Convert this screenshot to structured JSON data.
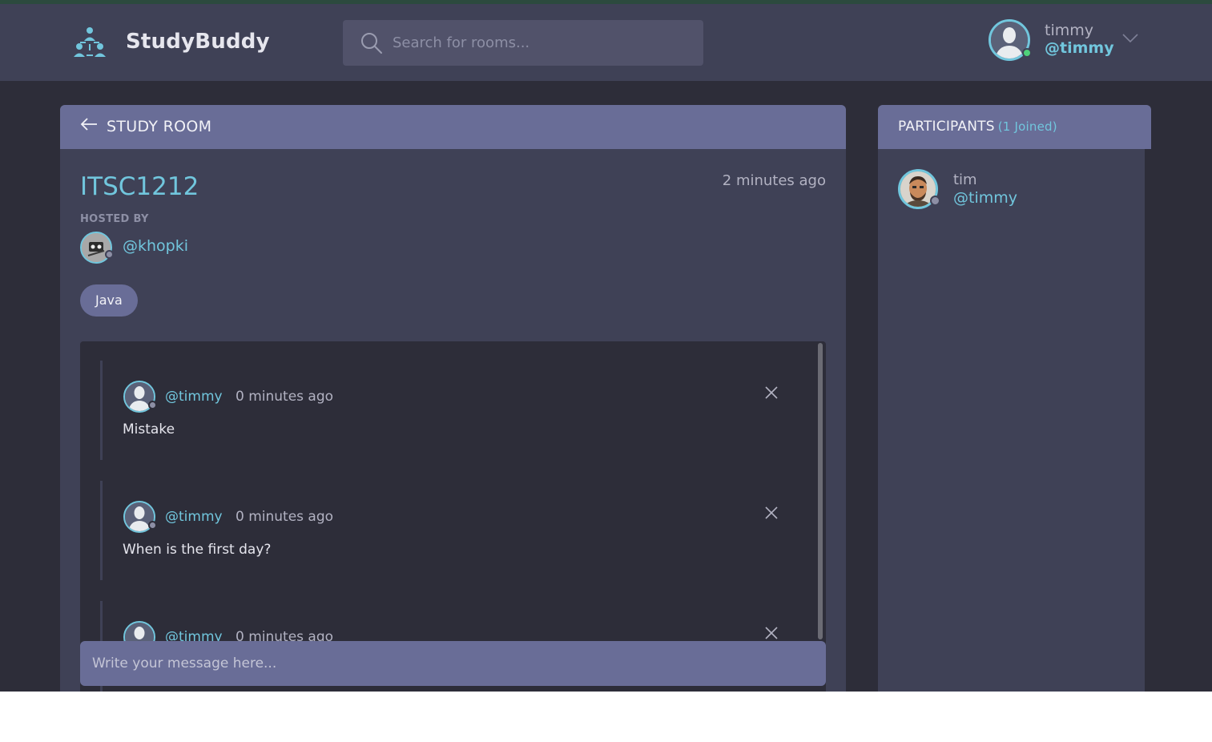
{
  "header": {
    "brand": "StudyBuddy",
    "search_placeholder": "Search for rooms...",
    "user": {
      "name": "timmy",
      "handle": "@timmy",
      "status": "online"
    }
  },
  "room": {
    "section_label": "STUDY ROOM",
    "title": "ITSC1212",
    "created": "2 minutes ago",
    "hosted_by_label": "HOSTED BY",
    "host_handle": "@khopki",
    "topic": "Java"
  },
  "messages": [
    {
      "handle": "@timmy",
      "time": "0 minutes ago",
      "body": "Mistake"
    },
    {
      "handle": "@timmy",
      "time": "0 minutes ago",
      "body": "When is the first day?"
    },
    {
      "handle": "@timmy",
      "time": "0 minutes ago",
      "body": ""
    }
  ],
  "composer": {
    "placeholder": "Write your message here..."
  },
  "participants": {
    "label": "PARTICIPANTS",
    "count_label": "(1 Joined)",
    "items": [
      {
        "name": "tim",
        "handle": "@timmy"
      }
    ]
  },
  "colors": {
    "accent": "#71c6dd",
    "header_bg": "#3f4156",
    "panel_head": "#696d97",
    "page_bg": "#2d2d39",
    "online": "#4fd17a"
  },
  "icons": {
    "logo": "people-network-icon",
    "search": "search-icon",
    "dropdown": "chevron-down-icon",
    "back": "arrow-left-icon",
    "delete": "close-icon"
  }
}
